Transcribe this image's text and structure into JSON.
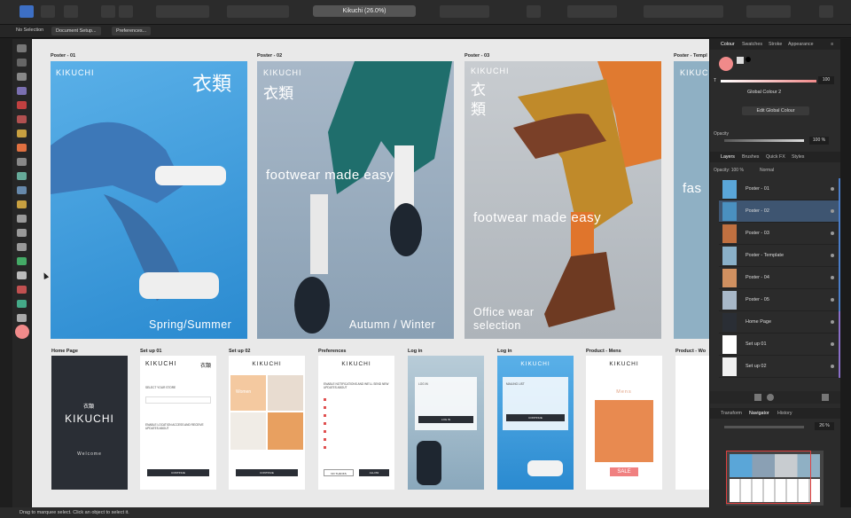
{
  "app": {
    "doc_title": "Kikuchi (26.0%)"
  },
  "context_toolbar": {
    "selection": "No Selection",
    "doc_setup": "Document Setup...",
    "preferences": "Preferences..."
  },
  "status_bar": {
    "text": "Drag to marquee select. Click an object to select it."
  },
  "canvas": {
    "posters": [
      {
        "label": "Poster - 01",
        "brand": "KIKUCHI",
        "kanji": "衣類",
        "tagline": "Spring/Summer"
      },
      {
        "label": "Poster - 02",
        "brand": "KIKUCHI",
        "kanji": "衣類",
        "tagline": "footwear made easy",
        "tagline2": "Autumn / Winter"
      },
      {
        "label": "Poster - 03",
        "brand": "KIKUCHI",
        "kanji": "衣類",
        "tagline": "footwear made easy",
        "tagline2": "Office wear selection"
      },
      {
        "label": "Poster - Templ",
        "brand": "KIKUCHI",
        "tagline": "fas"
      }
    ],
    "screens": [
      {
        "label": "Home Page",
        "brand": "KIKUCHI",
        "kanji": "衣類",
        "sub": "Welcome"
      },
      {
        "label": "Set up 01",
        "brand": "KIKUCHI",
        "kanji": "衣類",
        "text1": "SELECT YOUR STORE",
        "text2": "ENABLE LOCATION ACCESS AND RECEIVE UPDATES ABOUT",
        "button": "CONTINUE"
      },
      {
        "label": "Set up 02",
        "brand": "KIKUCHI",
        "text1": "Women",
        "button": "CONTINUE"
      },
      {
        "label": "Preferences",
        "brand": "KIKUCHI",
        "text1": "ENABLE NOTIFICATIONS AND WE'LL SEND NEW UPDATES ABOUT",
        "button1": "NO THANKS",
        "button2": "ALLOW"
      },
      {
        "label": "Log in",
        "text1": "LOG IN",
        "button": "LOG IN"
      },
      {
        "label": "Log in",
        "brand": "KIKUCHI",
        "text1": "MAILING LIST",
        "button": "CONTINUE"
      },
      {
        "label": "Product - Mens",
        "brand": "KIKUCHI",
        "text1": "Mens",
        "badge": "SALE"
      },
      {
        "label": "Product - Wo",
        "text1": ""
      }
    ]
  },
  "panel": {
    "colour_tabs": [
      "Colour",
      "Swatches",
      "Stroke",
      "Appearance"
    ],
    "global_colour": "Global Colour 2",
    "edit_global": "Edit Global Colour",
    "opacity_label": "Opacity",
    "opacity_value": "100 %",
    "tint_value": "100",
    "tint_label": "T",
    "layer_tabs": [
      "Layers",
      "Brushes",
      "Quick FX",
      "Styles"
    ],
    "layer_opacity": "Opacity: 100 %",
    "blend_mode": "Normal",
    "layers": [
      {
        "name": "Poster - 01",
        "color": "#5aa6d8"
      },
      {
        "name": "Poster - 02",
        "color": "#4a90c0"
      },
      {
        "name": "Poster - 03",
        "color": "#c07040"
      },
      {
        "name": "Poster - Template",
        "color": "#8ab0c8"
      },
      {
        "name": "Poster - 04",
        "color": "#d09060"
      },
      {
        "name": "Poster - 05",
        "color": "#a8b8c8"
      },
      {
        "name": "Home Page",
        "color": "#2a2e35"
      },
      {
        "name": "Set up 01",
        "color": "#ffffff"
      },
      {
        "name": "Set up 02",
        "color": "#f0f0f0"
      }
    ],
    "nav_tabs": [
      "Transform",
      "Navigator",
      "History"
    ],
    "zoom_value": "26 %"
  },
  "colors": {
    "accent": "#4a7dc8",
    "selected_layer": "#3e5571",
    "swatch": "#f08a8a",
    "sale": "#f08080"
  }
}
